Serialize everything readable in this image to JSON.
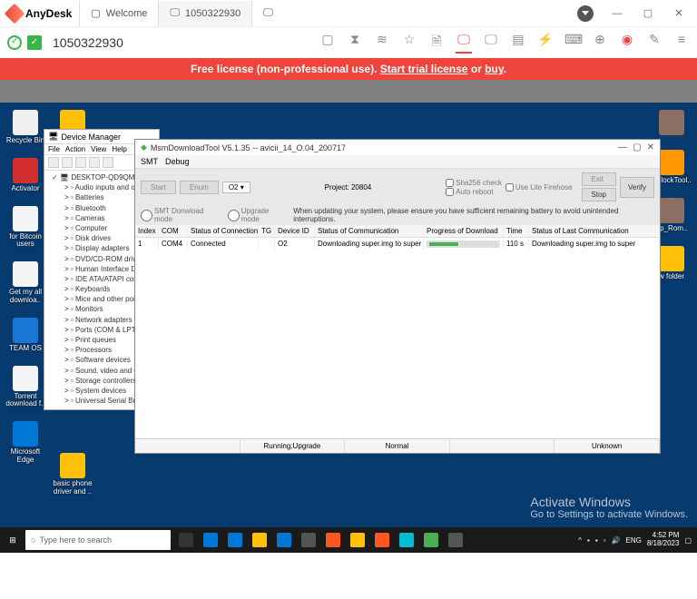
{
  "anydesk": {
    "brand": "AnyDesk",
    "tab_welcome": "Welcome",
    "tab_session": "1050322930",
    "session_id": "1050322930",
    "banner_prefix": "Free license (non-professional use). ",
    "banner_link1": "Start trial license",
    "banner_mid": " or ",
    "banner_link2": "buy",
    "banner_suffix": "."
  },
  "devmgr": {
    "title": "Device Manager",
    "menu": {
      "file": "File",
      "action": "Action",
      "view": "View",
      "help": "Help"
    },
    "root": "DESKTOP-QD9QM1V",
    "nodes": [
      "Audio inputs and ou",
      "Batteries",
      "Bluetooth",
      "Cameras",
      "Computer",
      "Disk drives",
      "Display adapters",
      "DVD/CD-ROM drives",
      "Human Interface Dev",
      "IDE ATA/ATAPI contr",
      "Keyboards",
      "Mice and other point",
      "Monitors",
      "Network adapters",
      "Ports (COM & LPT)",
      "Print queues",
      "Processors",
      "Software devices",
      "Sound, video and ga",
      "Storage controllers",
      "System devices",
      "Universal Serial Bus c"
    ]
  },
  "msm": {
    "title": "MsmDownloadTool V5.1.35 -- avicii_14_O.04_200717",
    "menu": {
      "smt": "SMT",
      "debug": "Debug"
    },
    "btn_start": "Start",
    "btn_enum": "Enum",
    "sel_o2": "O2",
    "project_lbl": "Project:",
    "project_val": "20804",
    "chk_sha": "Sha256 check",
    "chk_fire": "Use Lite Firehose",
    "chk_auto": "Auto reboot",
    "btn_exit": "Exit",
    "btn_verify": "Verify",
    "btn_stop": "Stop",
    "radio_dl": "SMT Donwload mode",
    "radio_up": "Upgrade mode",
    "warn": "When updating your system, please ensure you have sufficient remaining battery to avoid unintended interruptions.",
    "cols": {
      "idx": "Index",
      "com": "COM",
      "soc": "Status of Connection",
      "tg": "TG",
      "dev": "Device ID",
      "comm": "Status of Communication",
      "prog": "Progress of Download",
      "time": "Time",
      "last": "Status of Last Communication"
    },
    "row": {
      "idx": "1",
      "com": "COM4",
      "soc": "Connected",
      "tg": "",
      "dev": "O2",
      "comm": "Downloading super.img to super",
      "time": "110 s",
      "last": "Downloading super.img to super"
    },
    "status": {
      "s1": "",
      "s2": "Running:Upgrade",
      "s3": "Normal",
      "s4": "",
      "s5": "Unknown"
    }
  },
  "desktop": {
    "left": [
      {
        "l": "Recycle Bin",
        "c": "#f0f0f0"
      },
      {
        "l": "Activator",
        "c": "#d32f2f"
      },
      {
        "l": "for Bitcoin users",
        "c": "#f5f5f5"
      },
      {
        "l": "Get my all downloa..",
        "c": "#f5f5f5"
      },
      {
        "l": "TEAM OS",
        "c": "#1976d2"
      },
      {
        "l": "Torrent download f..",
        "c": "#f5f5f5"
      },
      {
        "l": "Microsoft Edge",
        "c": "#0078d7"
      }
    ],
    "left2": [
      {
        "l": "",
        "c": "#ffc107"
      },
      {
        "l": "",
        "c": "#8d6e63"
      },
      {
        "l": "basic phone driver and ..",
        "c": "#ffc107"
      }
    ],
    "right": [
      {
        "l": "",
        "c": "#8d6e63"
      },
      {
        "l": "UnlockTool..",
        "c": "#ff9800"
      },
      {
        "l": "up_Rom..",
        "c": "#8d6e63"
      },
      {
        "l": "w folder",
        "c": "#ffc107"
      }
    ]
  },
  "activate": {
    "t": "Activate Windows",
    "s": "Go to Settings to activate Windows."
  },
  "taskbar": {
    "search": "Type here to search",
    "apps": [
      "#333",
      "#0078d7",
      "#0078d7",
      "#ffc107",
      "#0078d7",
      "#555",
      "#ff5722",
      "#ffc107",
      "#ff5722",
      "#00bcd4",
      "#4caf50",
      "#555"
    ],
    "lang": "ENG",
    "time": "4:52 PM",
    "date": "8/18/2023"
  }
}
